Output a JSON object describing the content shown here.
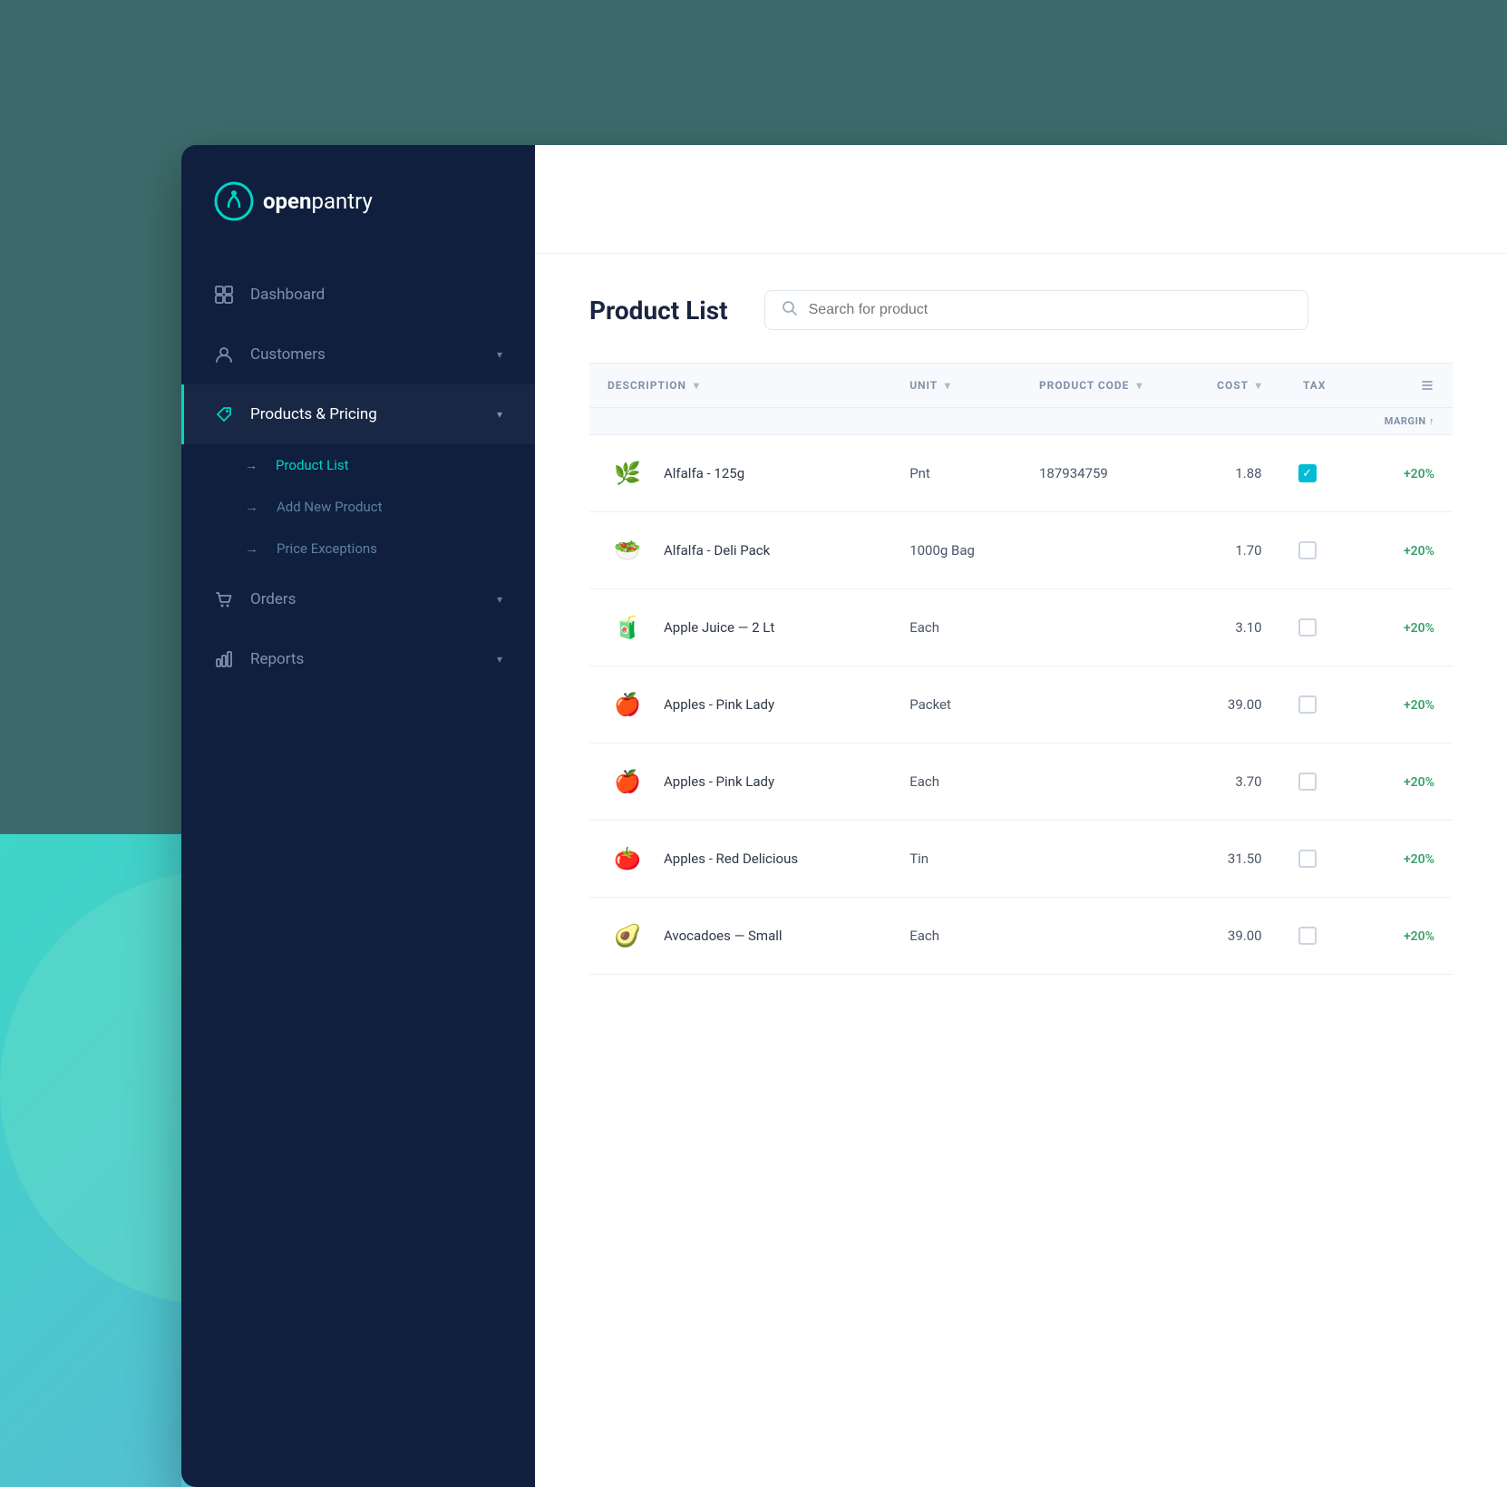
{
  "app": {
    "name_open": "open",
    "name_pantry": "pantry"
  },
  "sidebar": {
    "nav_items": [
      {
        "id": "dashboard",
        "label": "Dashboard",
        "icon": "grid-icon",
        "active": false,
        "has_arrow": false
      },
      {
        "id": "customers",
        "label": "Customers",
        "icon": "user-icon",
        "active": false,
        "has_arrow": true
      },
      {
        "id": "products-pricing",
        "label": "Products & Pricing",
        "icon": "tag-icon",
        "active": true,
        "has_arrow": true
      },
      {
        "id": "orders",
        "label": "Orders",
        "icon": "cart-icon",
        "active": false,
        "has_arrow": true
      },
      {
        "id": "reports",
        "label": "Reports",
        "icon": "bar-chart-icon",
        "active": false,
        "has_arrow": true
      }
    ],
    "sub_items": [
      {
        "id": "product-list",
        "label": "Product List",
        "active": true
      },
      {
        "id": "add-new-product",
        "label": "Add New Product",
        "active": false
      },
      {
        "id": "price-exceptions",
        "label": "Price Exceptions",
        "active": false
      }
    ]
  },
  "main": {
    "page_title": "Product List",
    "search_placeholder": "Search for product"
  },
  "table": {
    "headers": [
      {
        "id": "description",
        "label": "DESCRIPTION",
        "sortable": true
      },
      {
        "id": "unit",
        "label": "UNIT",
        "sortable": true
      },
      {
        "id": "product-code",
        "label": "PRODUCT CODE",
        "sortable": true
      },
      {
        "id": "cost",
        "label": "COST",
        "sortable": true
      },
      {
        "id": "tax",
        "label": "TAX",
        "sortable": false
      },
      {
        "id": "price",
        "label": "",
        "sortable": false
      }
    ],
    "price_sub_header": "Margin ↑",
    "rows": [
      {
        "id": 1,
        "image": "🌿",
        "name": "Alfalfa - 125g",
        "unit": "Pnt",
        "product_code": "187934759",
        "cost": "1.88",
        "tax_checked": true,
        "price_margin": "+20%"
      },
      {
        "id": 2,
        "image": "🥗",
        "name": "Alfalfa - Deli Pack",
        "unit": "1000g Bag",
        "product_code": "",
        "cost": "1.70",
        "tax_checked": false,
        "price_margin": "+20%"
      },
      {
        "id": 3,
        "image": "🧃",
        "name": "Apple Juice — 2 Lt",
        "unit": "Each",
        "product_code": "",
        "cost": "3.10",
        "tax_checked": false,
        "price_margin": "+20%"
      },
      {
        "id": 4,
        "image": "🍎",
        "name": "Apples - Pink Lady",
        "unit": "Packet",
        "product_code": "",
        "cost": "39.00",
        "tax_checked": false,
        "price_margin": "+20%"
      },
      {
        "id": 5,
        "image": "🍎",
        "name": "Apples - Pink Lady",
        "unit": "Each",
        "product_code": "",
        "cost": "3.70",
        "tax_checked": false,
        "price_margin": "+20%"
      },
      {
        "id": 6,
        "image": "🍅",
        "name": "Apples - Red Delicious",
        "unit": "Tin",
        "product_code": "",
        "cost": "31.50",
        "tax_checked": false,
        "price_margin": "+20%"
      },
      {
        "id": 7,
        "image": "🥑",
        "name": "Avocadoes — Small",
        "unit": "Each",
        "product_code": "",
        "cost": "39.00",
        "tax_checked": false,
        "price_margin": "+20%"
      }
    ]
  }
}
